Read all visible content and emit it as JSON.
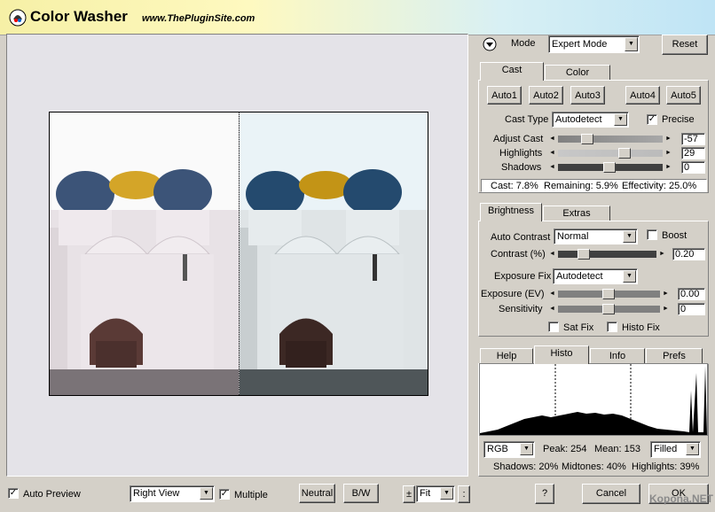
{
  "app": {
    "title": "Color Washer",
    "url": "www.ThePluginSite.com"
  },
  "mode": {
    "label": "Mode",
    "value": "Expert Mode",
    "reset_label": "Reset"
  },
  "cast_tabs": {
    "tab1": "Cast",
    "tab2": "Color"
  },
  "auto_buttons": [
    "Auto1",
    "Auto2",
    "Auto3",
    "Auto4",
    "Auto5"
  ],
  "cast": {
    "type_label": "Cast Type",
    "type_value": "Autodetect",
    "precise_label": "Precise",
    "precise_checked": true,
    "adjust_label": "Adjust Cast",
    "adjust_value": "-57",
    "highlights_label": "Highlights",
    "highlights_value": "29",
    "shadows_label": "Shadows",
    "shadows_value": "0",
    "status_cast": "Cast: 7.8%",
    "status_remaining": "Remaining: 5.9%",
    "status_effectivity": "Effectivity: 25.0%"
  },
  "bright_tabs": {
    "tab1": "Brightness",
    "tab2": "Extras"
  },
  "brightness": {
    "auto_contrast_label": "Auto Contrast",
    "auto_contrast_value": "Normal",
    "boost_label": "Boost",
    "contrast_label": "Contrast (%)",
    "contrast_value": "0.20",
    "exposure_fix_label": "Exposure Fix",
    "exposure_fix_value": "Autodetect",
    "exposure_ev_label": "Exposure (EV)",
    "exposure_ev_value": "0.00",
    "sensitivity_label": "Sensitivity",
    "sensitivity_value": "0",
    "satfix_label": "Sat Fix",
    "histofix_label": "Histo Fix"
  },
  "histo_tabs": {
    "help": "Help",
    "histo": "Histo",
    "info": "Info",
    "prefs": "Prefs"
  },
  "histo": {
    "channel": "RGB",
    "peak": "Peak: 254",
    "mean": "Mean: 153",
    "display": "Filled",
    "shadows": "Shadows: 20%",
    "midtones": "Midtones: 40%",
    "highlights": "Highlights: 39%"
  },
  "bottom": {
    "auto_preview_label": "Auto Preview",
    "view_value": "Right View",
    "multiple_label": "Multiple",
    "neutral_label": "Neutral",
    "bw_label": "B/W",
    "plus_label": "±",
    "zoom_value": "Fit",
    "dot_label": ":",
    "help_label": "?",
    "cancel_label": "Cancel",
    "ok_label": "OK"
  },
  "watermark": "Kopona.NET",
  "colors": {
    "accent": "#c00000",
    "title_grad_start": "#f6f0a6",
    "title_grad_end": "#bfe4f5"
  }
}
